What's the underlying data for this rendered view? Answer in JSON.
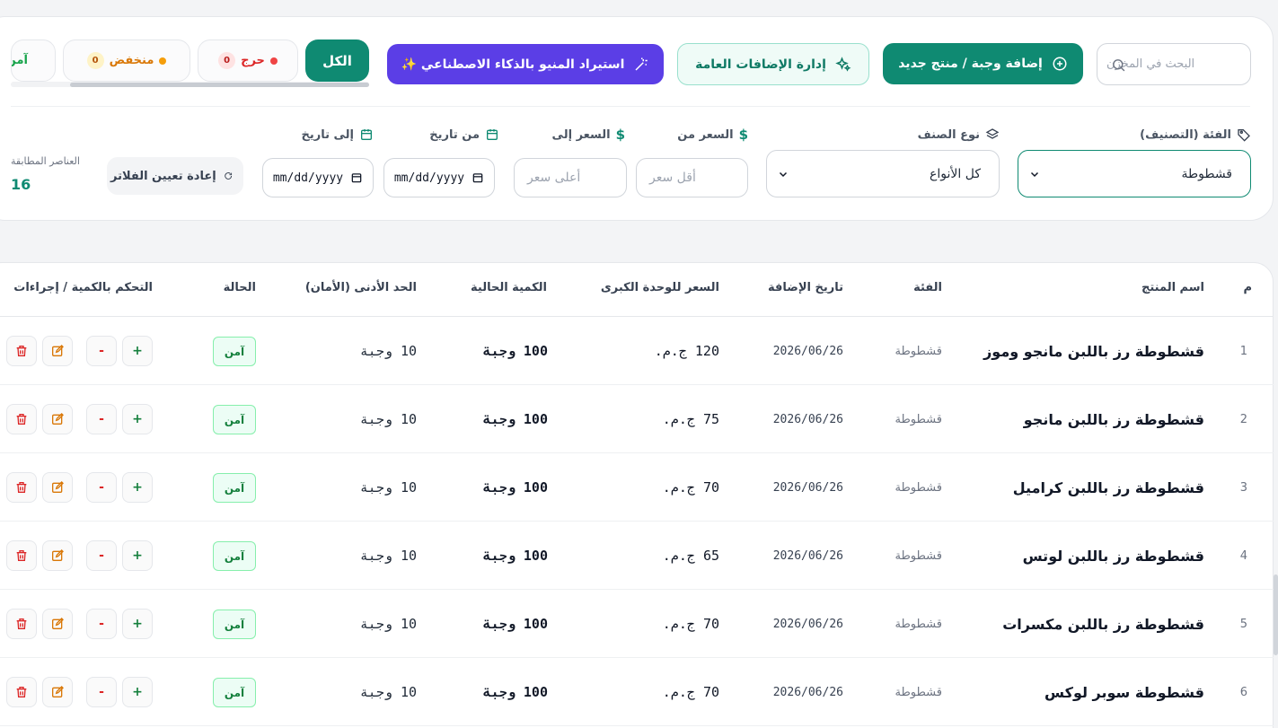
{
  "toolbar": {
    "search_placeholder": "البحث في المخزن",
    "add_button": "إضافة وجبة / منتج جديد",
    "addons_button": "إدارة الإضافات العامة",
    "ai_button": "استيراد المنيو بالذكاء الاصطناعي ✨"
  },
  "status_filters": [
    {
      "label": "الكل"
    },
    {
      "label": "حرج",
      "count": "0",
      "color": "#dc2626"
    },
    {
      "label": "منخفض",
      "count": "0",
      "color": "#d97706"
    },
    {
      "label": "آمن",
      "color": "#16a34a"
    }
  ],
  "filters": {
    "category_label": "الفئة (التصنيف)",
    "category_value": "قشطوطة",
    "type_label": "نوع الصنف",
    "type_value": "كل الأنواع",
    "price_from_label": "السعر من",
    "price_from_placeholder": "أقل سعر",
    "price_to_label": "السعر إلى",
    "price_to_placeholder": "أعلى سعر",
    "date_from_label": "من تاريخ",
    "date_to_label": "إلى تاريخ",
    "date_placeholder": "mm/dd/yyyy",
    "reset_button": "إعادة تعيين الفلاتر",
    "matched_label": "العناصر المطابقة",
    "matched_count": "16"
  },
  "table": {
    "headers": {
      "index": "م",
      "name": "اسم المنتج",
      "category": "الفئة",
      "date": "تاريخ الإضافة",
      "price": "السعر للوحدة الكبرى",
      "qty": "الكمية الحالية",
      "min": "الحد الأدنى (الأمان)",
      "status": "الحالة",
      "actions": "التحكم بالكمية / إجراءات"
    },
    "rows": [
      {
        "idx": "1",
        "name": "قشطوطة رز باللبن مانجو وموز",
        "category": "قشطوطة",
        "date": "2026/06/26",
        "price": "120 ج.م.",
        "qty": "100 وجبة",
        "min": "10 وجبة",
        "status": "آمن"
      },
      {
        "idx": "2",
        "name": "قشطوطة رز باللبن مانجو",
        "category": "قشطوطة",
        "date": "2026/06/26",
        "price": "75 ج.م.",
        "qty": "100 وجبة",
        "min": "10 وجبة",
        "status": "آمن"
      },
      {
        "idx": "3",
        "name": "قشطوطة رز باللبن كراميل",
        "category": "قشطوطة",
        "date": "2026/06/26",
        "price": "70 ج.م.",
        "qty": "100 وجبة",
        "min": "10 وجبة",
        "status": "آمن"
      },
      {
        "idx": "4",
        "name": "قشطوطة رز باللبن لوتس",
        "category": "قشطوطة",
        "date": "2026/06/26",
        "price": "65 ج.م.",
        "qty": "100 وجبة",
        "min": "10 وجبة",
        "status": "آمن"
      },
      {
        "idx": "5",
        "name": "قشطوطة رز باللبن مكسرات",
        "category": "قشطوطة",
        "date": "2026/06/26",
        "price": "70 ج.م.",
        "qty": "100 وجبة",
        "min": "10 وجبة",
        "status": "آمن"
      },
      {
        "idx": "6",
        "name": "قشطوطة سوبر لوكس",
        "category": "قشطوطة",
        "date": "2026/06/26",
        "price": "70 ج.م.",
        "qty": "100 وجبة",
        "min": "10 وجبة",
        "status": "آمن"
      }
    ],
    "actions": {
      "plus": "+",
      "minus": "-"
    }
  }
}
